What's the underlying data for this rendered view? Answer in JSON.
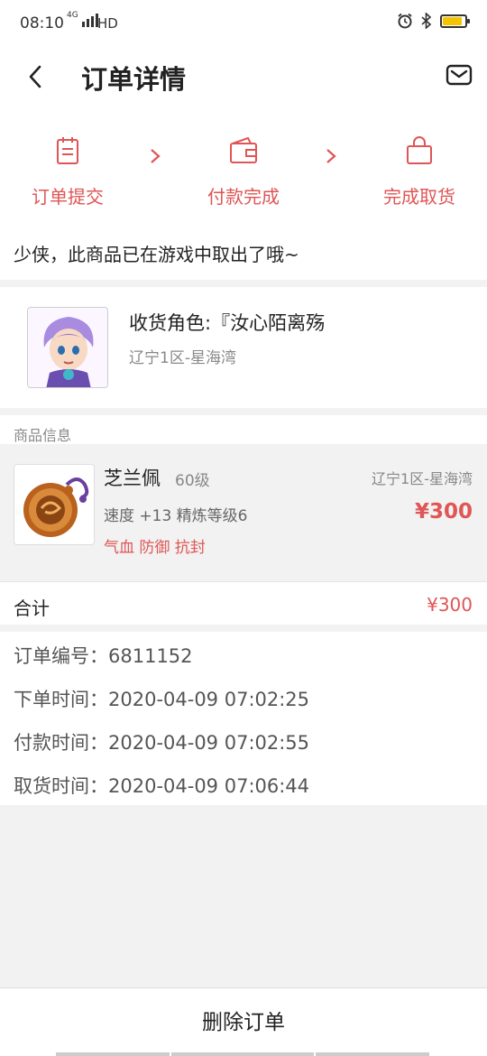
{
  "status_bar": {
    "time": "08:10",
    "network": "4G",
    "hd": "HD"
  },
  "header": {
    "title": "订单详情",
    "back_icon": "back-arrow-icon",
    "mail_icon": "mail-icon"
  },
  "steps": [
    {
      "label": "订单提交",
      "icon": "clipboard-icon"
    },
    {
      "label": "付款完成",
      "icon": "wallet-icon"
    },
    {
      "label": "完成取货",
      "icon": "bag-icon"
    }
  ],
  "notice": "少侠，此商品已在游戏中取出了哦~",
  "receiver": {
    "name": "收货角色:『汝心陌离殇",
    "server": "辽宁1区-星海湾"
  },
  "product_section_label": "商品信息",
  "product": {
    "name": "芝兰佩",
    "level": "60级",
    "server": "辽宁1区-星海湾",
    "attributes": "速度 +13 精炼等级6",
    "price": "¥300",
    "tags": "气血 防御 抗封"
  },
  "total": {
    "label": "合计",
    "value": "¥300"
  },
  "order_info": {
    "order_no": "订单编号：6811152",
    "order_time": "下单时间：2020-04-09 07:02:25",
    "pay_time": "付款时间：2020-04-09 07:02:55",
    "pickup_time": "取货时间：2020-04-09 07:06:44"
  },
  "actions": {
    "delete_label": "删除订单"
  },
  "colors": {
    "accent": "#e05555",
    "background": "#f2f2f2"
  }
}
